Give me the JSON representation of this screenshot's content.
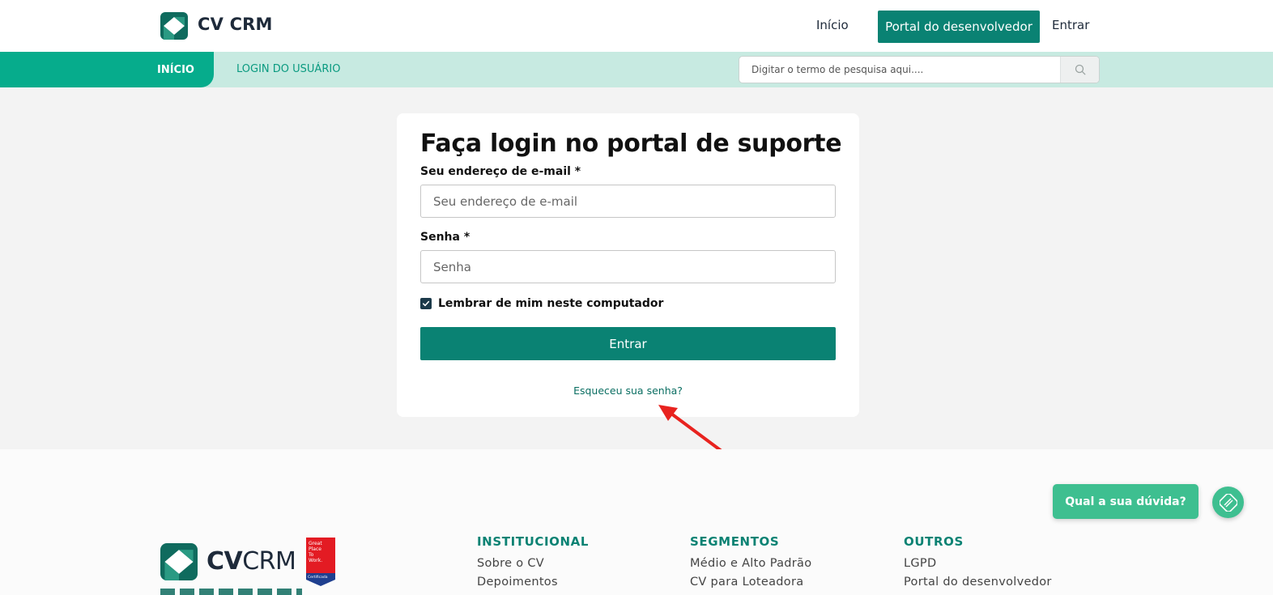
{
  "header": {
    "brand": "CV CRM",
    "nav": {
      "inicio": "Início",
      "portal": "Portal do desenvolvedor",
      "entrar": "Entrar"
    }
  },
  "subnav": {
    "tab_inicio": "INÍCIO",
    "tab_login": "LOGIN DO USUÁRIO",
    "search_placeholder": "Digitar o termo de pesquisa aqui...."
  },
  "login": {
    "title": "Faça login no portal de suporte",
    "email_label": "Seu endereço de e-mail *",
    "email_placeholder": "Seu endereço de e-mail",
    "password_label": "Senha *",
    "password_placeholder": "Senha",
    "remember_label": "Lembrar de mim neste computador",
    "remember_checked": true,
    "submit_label": "Entrar",
    "forgot_label": "Esqueceu sua senha?"
  },
  "footer": {
    "brand_bold": "CV",
    "brand_regular": "CRM",
    "columns": [
      {
        "title": "INSTITUCIONAL",
        "links": [
          "Sobre o CV",
          "Depoimentos"
        ]
      },
      {
        "title": "SEGMENTOS",
        "links": [
          "Médio e Alto Padrão",
          "CV para Loteadora"
        ]
      },
      {
        "title": "OUTROS",
        "links": [
          "LGPD",
          "Portal do desenvolvedor"
        ]
      }
    ]
  },
  "chat": {
    "label": "Qual a sua dúvida?"
  },
  "colors": {
    "primary": "#0a8273",
    "accent": "#06ac8c",
    "subnav_bg": "#c7eae1",
    "chat": "#3ebf90",
    "annotation_arrow": "#e8231f"
  }
}
